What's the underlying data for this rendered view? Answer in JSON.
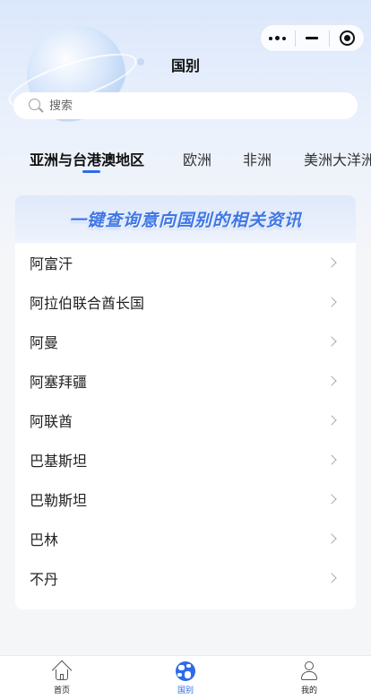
{
  "header": {
    "title": "国别"
  },
  "search": {
    "placeholder": "搜索"
  },
  "tabs": [
    {
      "label": "亚洲与台港澳地区"
    },
    {
      "label": "欧洲"
    },
    {
      "label": "非洲"
    },
    {
      "label": "美洲大洋洲"
    }
  ],
  "banner": {
    "text": "一键查询意向国别的相关资讯"
  },
  "countries": [
    {
      "label": "阿富汗"
    },
    {
      "label": "阿拉伯联合酋长国"
    },
    {
      "label": "阿曼"
    },
    {
      "label": "阿塞拜疆"
    },
    {
      "label": "阿联酋"
    },
    {
      "label": "巴基斯坦"
    },
    {
      "label": "巴勒斯坦"
    },
    {
      "label": "巴林"
    },
    {
      "label": "不丹"
    }
  ],
  "tabbar": {
    "items": [
      {
        "label": "首页",
        "icon": "home-icon"
      },
      {
        "label": "国别",
        "icon": "globe-icon"
      },
      {
        "label": "我的",
        "icon": "user-icon"
      }
    ]
  },
  "colors": {
    "accent": "#2f6be8",
    "banner_text": "#3f77e6"
  }
}
